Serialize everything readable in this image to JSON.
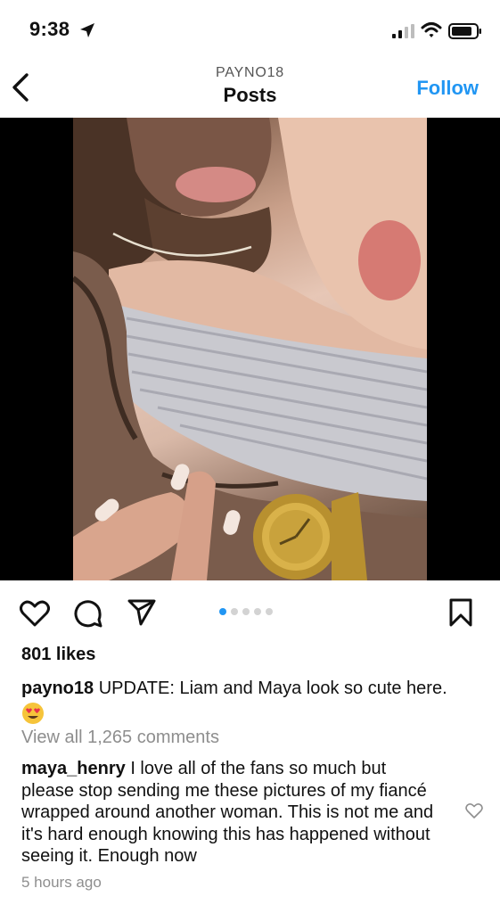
{
  "status_bar": {
    "time": "9:38",
    "icons": [
      "location-arrow-icon",
      "cellular-signal-icon",
      "wifi-icon",
      "battery-icon"
    ]
  },
  "header": {
    "subtitle": "PAYNO18",
    "title": "Posts",
    "follow_label": "Follow",
    "accent_color": "#2196f3"
  },
  "post": {
    "image_count": 5,
    "active_image_index": 0,
    "likes": "801 likes",
    "caption_user": "payno18",
    "caption_text": "UPDATE: Liam and Maya look so cute here.",
    "caption_emoji": "heart-eyes-emoji",
    "view_all_comments": "View all 1,265 comments",
    "comment_user": "maya_henry",
    "comment_text": "I love all of the fans so much but please stop sending me these pictures of my fiancé wrapped around another woman. This is not me and it's hard enough knowing this has happened without seeing it. Enough now",
    "timestamp": "5 hours ago"
  }
}
